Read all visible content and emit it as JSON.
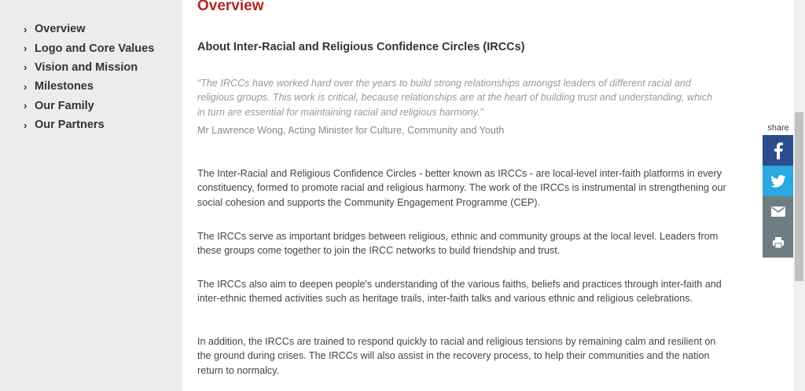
{
  "sidebar": {
    "items": [
      {
        "label": "Overview"
      },
      {
        "label": "Logo and Core Values"
      },
      {
        "label": "Vision and Mission"
      },
      {
        "label": "Milestones"
      },
      {
        "label": "Our Family"
      },
      {
        "label": "Our Partners"
      }
    ]
  },
  "main": {
    "title": "Overview",
    "heading": "About Inter-Racial and Religious Confidence Circles (IRCCs)",
    "quote": "“The IRCCs have worked hard over the years to build strong relationships amongst leaders of different racial and religious groups. This work is critical, because relationships are at the heart of building trust and understanding, which in turn are essential for maintaining racial and religious harmony.”",
    "attribution": "Mr Lawrence Wong, Acting Minister for Culture, Community and Youth",
    "paragraphs": [
      "The Inter-Racial and Religious Confidence Circles - better known as IRCCs - are local-level inter-faith platforms in every constituency, formed to promote racial and religious harmony.  The work of the IRCCs is instrumental in strengthening our social cohesion and supports the Community Engagement Programme (CEP).",
      "The IRCCs serve as important bridges between religious, ethnic and community groups at the local level. Leaders from these groups come together to join the IRCC networks to build friendship and trust.",
      "The IRCCs also aim to deepen people's understanding of the various faiths, beliefs and practices through inter-faith and inter-ethnic themed activities such as heritage trails, inter-faith talks and various ethnic and religious celebrations.",
      "In addition, the IRCCs are trained to respond quickly to racial and religious tensions by remaining calm and resilient on the ground during crises. The IRCCs will also assist in the recovery process, to help their communities and the nation return to normalcy."
    ]
  },
  "share": {
    "label": "share",
    "buttons": [
      {
        "icon": "facebook-icon",
        "color": "#2b4d8c"
      },
      {
        "icon": "twitter-icon",
        "color": "#2aa9e0"
      },
      {
        "icon": "email-icon",
        "color": "#6e7d82"
      },
      {
        "icon": "print-icon",
        "color": "#6e7d82"
      }
    ]
  },
  "colors": {
    "title": "#b5261e",
    "sidebar_bg": "#edecea"
  }
}
